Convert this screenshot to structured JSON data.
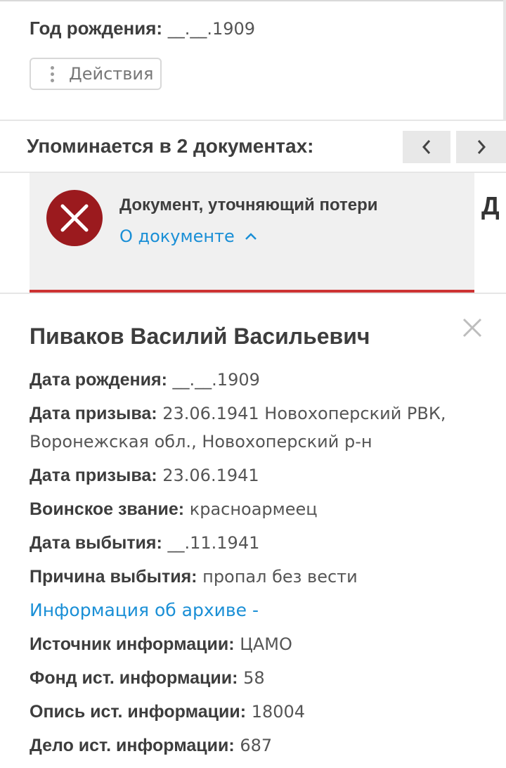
{
  "top": {
    "birth_label": "Год рождения:",
    "birth_value": "__.__.1909",
    "actions_label": "Действия"
  },
  "mentions": {
    "title": "Упоминается в 2 документах:"
  },
  "doc_card": {
    "title": "Документ, уточняющий потери",
    "link": "О документе",
    "next_peek": "Д"
  },
  "person": {
    "name": "Пиваков Василий Васильевич",
    "fields": [
      {
        "label": "Дата рождения:",
        "value": "__.__.1909"
      },
      {
        "label": "Дата призыва:",
        "value": "23.06.1941 Новохоперский РВК, Воронежская обл., Новохоперский р-н"
      },
      {
        "label": "Дата призыва:",
        "value": "23.06.1941"
      },
      {
        "label": "Воинское звание:",
        "value": "красноармеец"
      },
      {
        "label": "Дата выбытия:",
        "value": "__.11.1941"
      },
      {
        "label": "Причина выбытия:",
        "value": "пропал без вести"
      }
    ],
    "archive_link": "Информация об архиве -",
    "archive_fields": [
      {
        "label": "Источник информации:",
        "value": "ЦАМО"
      },
      {
        "label": "Фонд ист. информации:",
        "value": "58"
      },
      {
        "label": "Опись ист. информации:",
        "value": "18004"
      },
      {
        "label": "Дело ист. информации:",
        "value": "687"
      }
    ]
  },
  "colors": {
    "accent_link": "#1a8fd6",
    "doc_icon": "#9b1a1e",
    "card_underline": "#cc3333"
  }
}
